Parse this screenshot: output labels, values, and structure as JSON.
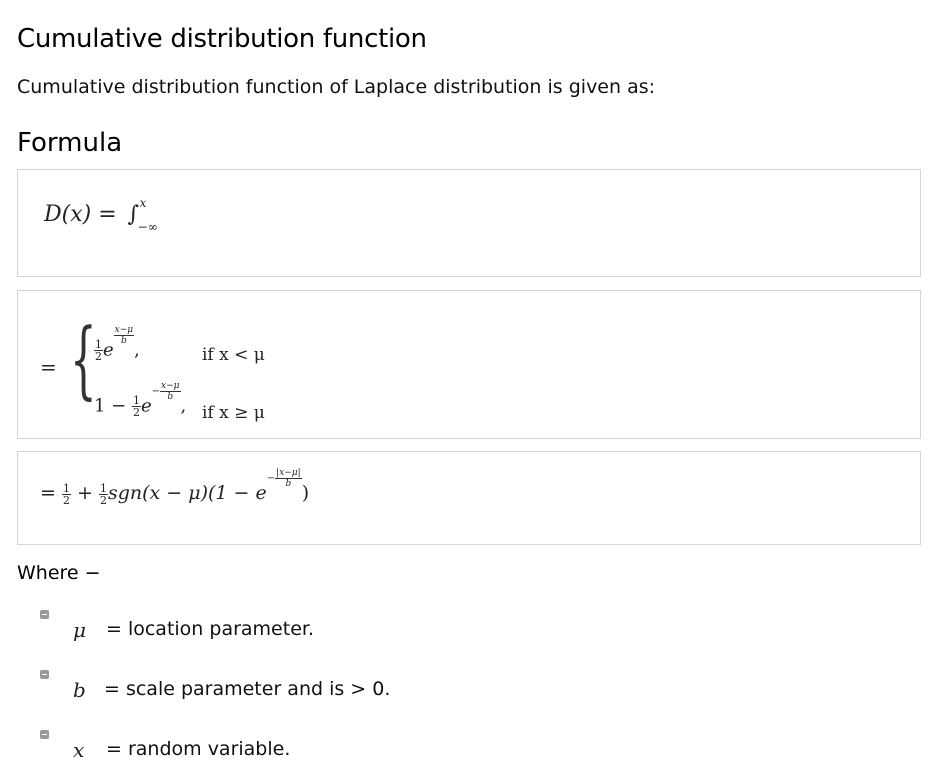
{
  "heading": "Cumulative distribution function",
  "intro": "Cumulative distribution function of Laplace distribution is given as:",
  "formula_heading": "Formula",
  "eq1": {
    "lhs": "D(x) = ",
    "integral": "∫",
    "upper": "x",
    "lower": "−∞"
  },
  "eq2": {
    "eq": "=",
    "half": {
      "num": "1",
      "den": "2"
    },
    "case1_prefix": "",
    "case1_e": "e",
    "case1_exp_num": "x−μ",
    "case1_exp_den": "b",
    "case1_comma": ",",
    "case1_cond": "if x < μ",
    "case2_prefix": "1 − ",
    "case2_e": "e",
    "case2_exp_minus": "−",
    "case2_exp_num": "x−μ",
    "case2_exp_den": "b",
    "case2_comma": ",",
    "case2_cond": "if x ≥ μ"
  },
  "eq3": {
    "eq": "= ",
    "plus": " + ",
    "sgn": "sgn(x − μ)(1 − e",
    "exp_minus": "−",
    "exp_num": "|x−μ|",
    "exp_den": "b",
    "close": ")"
  },
  "where_label": "Where −",
  "definitions": [
    {
      "symbol": "μ",
      "text": "= location parameter."
    },
    {
      "symbol": "b",
      "text": "= scale parameter and is > 0."
    },
    {
      "symbol": "x",
      "text": "= random variable."
    }
  ],
  "colors": {
    "box_border": "#d6d6d6",
    "bullet": "#9a9a9a"
  }
}
